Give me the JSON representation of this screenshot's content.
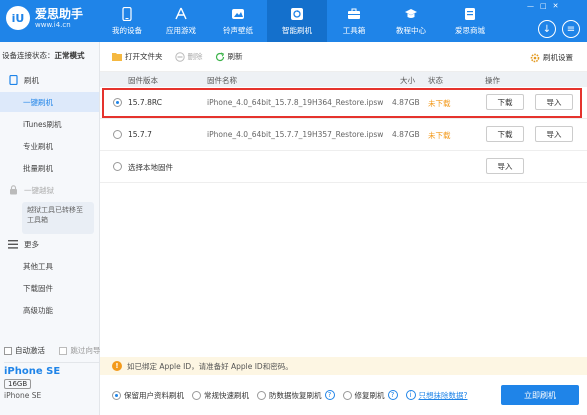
{
  "app": {
    "logo_mark": "iU",
    "name": "爱思助手",
    "url": "www.i4.cn"
  },
  "nav": [
    {
      "label": "我的设备",
      "icon": "phone-icon"
    },
    {
      "label": "应用游戏",
      "icon": "appstore-icon"
    },
    {
      "label": "铃声壁纸",
      "icon": "wallpaper-icon"
    },
    {
      "label": "智能刷机",
      "icon": "flash-icon",
      "active": true
    },
    {
      "label": "工具箱",
      "icon": "toolbox-icon"
    },
    {
      "label": "教程中心",
      "icon": "graduation-cap-icon"
    },
    {
      "label": "爱思商城",
      "icon": "shop-icon"
    }
  ],
  "header_buttons": {
    "download": "↓",
    "menu": "≡"
  },
  "window_controls": {
    "minimize": "—",
    "maximize": "□",
    "close": "✕"
  },
  "sidebar": {
    "status_label": "设备连接状态：",
    "status_value": "正常模式",
    "section_flash": "刷机",
    "items_flash": [
      "一键刷机",
      "iTunes刷机",
      "专业刷机",
      "批量刷机"
    ],
    "section_jailbreak": "一键越狱",
    "jailbreak_note": "越狱工具已转移至工具箱",
    "section_more": "更多",
    "items_more": [
      "其他工具",
      "下载固件",
      "高级功能"
    ],
    "auto_activate": "自动激活",
    "skip_guide": "跳过向导",
    "device_name": "iPhone SE",
    "device_capacity": "16GB",
    "device_model": "iPhone SE"
  },
  "toolbar": {
    "open_folder": "打开文件夹",
    "delete": "删除",
    "refresh": "刷新",
    "settings": "刷机设置"
  },
  "table": {
    "headers": {
      "version": "固件版本",
      "name": "固件名称",
      "size": "大小",
      "status": "状态",
      "action": "操作"
    },
    "rows": [
      {
        "version": "15.7.8RC",
        "name": "iPhone_4.0_64bit_15.7.8_19H364_Restore.ipsw",
        "size": "4.87GB",
        "status": "未下载",
        "btn_download": "下载",
        "btn_import": "导入"
      },
      {
        "version": "15.7.7",
        "name": "iPhone_4.0_64bit_15.7.7_19H357_Restore.ipsw",
        "size": "4.87GB",
        "status": "未下载",
        "btn_download": "下载",
        "btn_import": "导入"
      }
    ],
    "local_firmware": "选择本地固件",
    "local_import": "导入"
  },
  "notice": {
    "icon": "!",
    "text": "如已绑定 Apple ID，请准备好 Apple ID和密码。"
  },
  "options": {
    "keep_data": "保留用户资料刷机",
    "quick_flash": "常规快速刷机",
    "anti_recovery": "防数据恢复刷机",
    "repair_flash": "修复刷机",
    "erase_link": "只想抹除数据?",
    "flash_now": "立即刷机"
  }
}
